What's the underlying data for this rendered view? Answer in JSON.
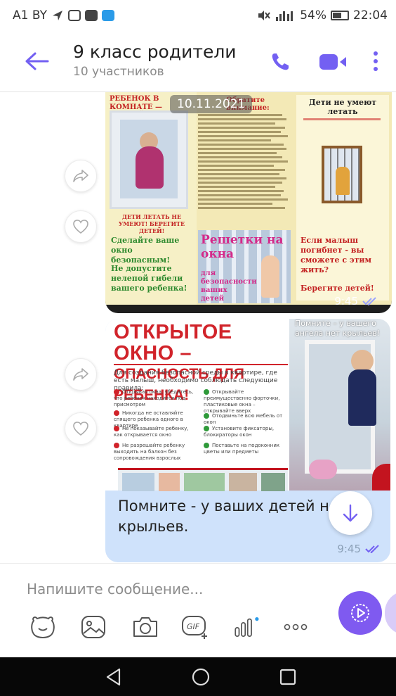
{
  "status_bar": {
    "carrier": "A1 BY",
    "battery": "54%",
    "battery_level": 0.54,
    "time": "22:04"
  },
  "header": {
    "title": "9 класс родители",
    "subtitle": "10 участников",
    "icons": [
      "back-arrow-icon",
      "phone-icon",
      "video-call-icon",
      "more-vert-icon"
    ],
    "accent_color": "#7360f2"
  },
  "messages": [
    {
      "type": "image",
      "date_badge": "10.11.2021",
      "time": "9:45",
      "poster": {
        "left_title": "РЕБЕНОК В КОМНАТЕ — ЗАКРОЙ ОКНО!",
        "left_caption": "ДЕТИ ЛЕТАТЬ НЕ УМЕЮТ! БЕРЕГИТЕ ДЕТЕЙ!",
        "left_text_1": "Сделайте ваше окно безопасным!",
        "left_text_2": "Не допустите нелепой гибели вашего ребенка!",
        "middle_title": "Обратите внимание:",
        "middle_banner": "Решетки на окна",
        "middle_banner_sub": "для безопасности ваших детей",
        "right_title": "Дети не умеют летать",
        "right_text_1": "Если малыш погибнет - вы сможете с этим жить?",
        "right_text_2": "Берегите детей!"
      }
    },
    {
      "type": "image_with_text",
      "time": "9:45",
      "poster": {
        "title_line_1": "ОТКРЫТОЕ ОКНО –",
        "title_line_2": "ОПАСНОСТЬ ДЛЯ РЕБЕНКА!",
        "photo_caption": "Помните – у вашего ангела нет крыльев!",
        "intro": "Для создания безопасной среды в квартире, где есть малыш, необходимо соблюдать следующие правила:",
        "rules_red": [
          "Открывая окна, убедитесь, что ребенок находится под присмотром",
          "Никогда не оставляйте спящего ребенка одного в квартире",
          "Не показывайте ребенку, как открывается окно",
          "Не разрешайте ребенку выходить на балкон без сопровождения взрослых"
        ],
        "rules_green": [
          "Открывайте преимущественно форточки, пластиковые окна – открывайте вверх",
          "Отодвиньте всю мебель от окон",
          "Установите фиксаторы, блокираторы окон",
          "Поставьте на подоконник цветы или предметы"
        ]
      },
      "text": "Помните - у ваших детей нет крыльев."
    }
  ],
  "composer": {
    "placeholder": "Напишите сообщение...",
    "tools": [
      "sticker-icon",
      "gallery-icon",
      "camera-icon",
      "gif-icon",
      "poll-icon",
      "more-horiz-icon"
    ]
  },
  "nav_bar": {
    "buttons": [
      "back-triangle-icon",
      "home-circle-icon",
      "recents-square-icon"
    ]
  }
}
